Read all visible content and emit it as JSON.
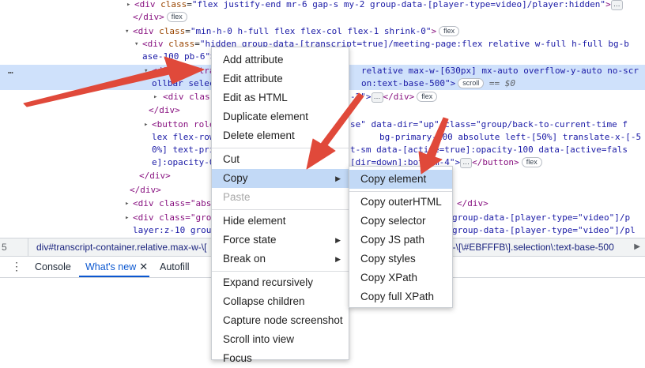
{
  "tree": {
    "row0": {
      "prefix": "▸ ",
      "tag_open": "<div ",
      "attr": "class",
      "value": "\"flex justify-end mr-6 gap-s my-2 group-data-[player-type=video]/player:hidden\"",
      "tail": ">",
      "ellipsis": "…"
    },
    "row1": {
      "text": "</div>",
      "badge": "flex"
    },
    "row2": {
      "prefix": "▾ ",
      "tag_open": "<div ",
      "attr": "class",
      "value": "\"min-h-0 h-full flex flex-col flex-1 shrink-0\"",
      "tail": ">",
      "badge": "flex"
    },
    "row3": {
      "prefix": "▾ ",
      "tag_open": "<div ",
      "attr": "class",
      "value": "\"hidden group-data-[transcript=true]/meeting-page:flex relative w-full h-full bg-b"
    },
    "row4": {
      "text": "ase-100 pb-6\">"
    },
    "row5": {
      "dots": "…",
      "left": "<div id=\"tra",
      "right": "relative max-w-[630px] mx-auto overflow-y-auto no-scr"
    },
    "row6": {
      "left": "ollbar selec",
      "right": "on:text-base-500\">",
      "badge": "scroll",
      "eq": "== $0"
    },
    "row7": {
      "prefix": "▸ ",
      "left": "<div clas",
      "right": "-2\">",
      "ellipsis": "…",
      "close": "</div>",
      "badge": "flex"
    },
    "row8": {
      "text": "</div>"
    },
    "row9": {
      "prefix": "▸ ",
      "left": "<button role",
      "right": "se\" data-dir=\"up\" class=\"group/back-to-current-time f"
    },
    "row10": {
      "left": "lex flex-row",
      "right": "bg-primary-100 absolute left-[50%] translate-x-[-5"
    },
    "row11": {
      "left": "0%] text-pri",
      "right": "t-sm data-[active=true]:opacity-100 data-[active=fals"
    },
    "row12": {
      "left": "e]:opacity-0",
      "right": "[dir=down]:bottom-4\">",
      "ellipsis": "…",
      "close": "</button>",
      "badge": "flex"
    },
    "row13": {
      "text": "</div>"
    },
    "row14": {
      "text": "</div>"
    },
    "row15": {
      "prefix": "▸ ",
      "left": "<div class=\"abs",
      "right": "</div>"
    },
    "row16": {
      "prefix": "▸ ",
      "left": "<div class=\"gro",
      "right": "group-data-[player-type=\"video\"]/p"
    },
    "row17": {
      "left": "layer:z-10 grou",
      "right": "group-data-[player-type=\"video\"]/pl"
    }
  },
  "breadcrumb": {
    "left": "5",
    "item1": "div#transcript-container.relative.max-w-\\[",
    "item2": "g-\\[\\#EBFFFB\\].selection\\:text-base-500",
    "scroll_right": "▶"
  },
  "drawer": {
    "tabs": [
      {
        "label": "Console"
      },
      {
        "label": "What's new",
        "close": "✕"
      },
      {
        "label": "Autofill"
      }
    ]
  },
  "menu_main": {
    "items": [
      "Add attribute",
      "Edit attribute",
      "Edit as HTML",
      "Duplicate element",
      "Delete element",
      "Cut",
      "Copy",
      "Paste",
      "Hide element",
      "Force state",
      "Break on",
      "Expand recursively",
      "Collapse children",
      "Capture node screenshot",
      "Scroll into view",
      "Focus"
    ],
    "submenu_arrow": "▶"
  },
  "menu_copy": {
    "items": [
      "Copy element",
      "Copy outerHTML",
      "Copy selector",
      "Copy JS path",
      "Copy styles",
      "Copy XPath",
      "Copy full XPath"
    ]
  },
  "colors": {
    "selected_row": "#cfe1fb",
    "menu_highlight": "#c2d9f6",
    "annotation_arrow": "#e0493a",
    "active_tab": "#0b57d0"
  }
}
